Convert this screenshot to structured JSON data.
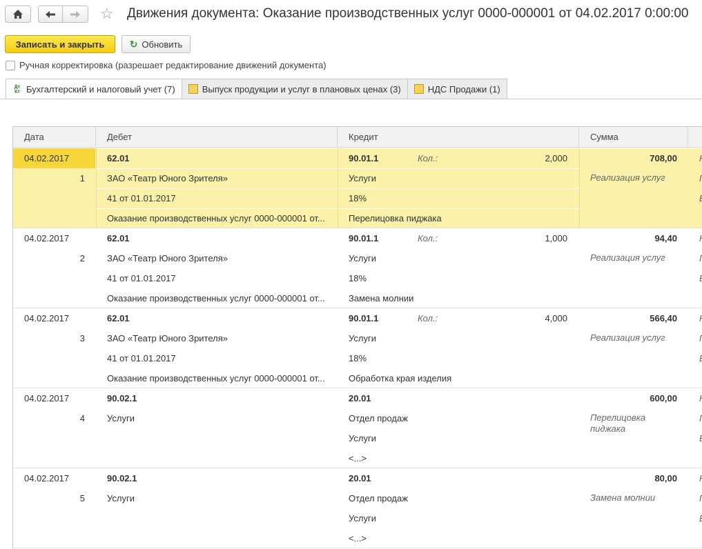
{
  "title": "Движения документа: Оказание производственных услуг 0000-000001 от 04.02.2017 0:00:00",
  "toolbar": {
    "save_close": "Записать и закрыть",
    "refresh": "Обновить"
  },
  "manual_edit": {
    "label": "Ручная корректировка (разрешает редактирование движений документа)",
    "checked": false
  },
  "tabs": [
    {
      "label": "Бухгалтерский и налоговый учет (7)",
      "active": true
    },
    {
      "label": "Выпуск продукции и услуг в плановых ценах (3)",
      "active": false
    },
    {
      "label": "НДС Продажи (1)",
      "active": false
    }
  ],
  "columns": {
    "date": "Дата",
    "debit": "Дебет",
    "credit": "Кредит",
    "sum": "Сумма"
  },
  "rows": [
    {
      "date": "04.02.2017",
      "num": "1",
      "debit": [
        "62.01",
        "ЗАО «Театр Юного Зрителя»",
        "41 от 01.01.2017",
        "Оказание производственных услуг 0000-000001 от..."
      ],
      "credit": [
        "90.01.1",
        "Услуги",
        "18%",
        "Перелицовка пиджака"
      ],
      "qty_label": "Кол.:",
      "qty": "2,000",
      "sum": "708,00",
      "content": "Реализация услуг",
      "extra": [
        "Н",
        "П",
        "Е"
      ]
    },
    {
      "date": "04.02.2017",
      "num": "2",
      "debit": [
        "62.01",
        "ЗАО «Театр Юного Зрителя»",
        "41 от 01.01.2017",
        "Оказание производственных услуг 0000-000001 от..."
      ],
      "credit": [
        "90.01.1",
        "Услуги",
        "18%",
        "Замена молнии"
      ],
      "qty_label": "Кол.:",
      "qty": "1,000",
      "sum": "94,40",
      "content": "Реализация услуг",
      "extra": [
        "Н",
        "П",
        "Е"
      ]
    },
    {
      "date": "04.02.2017",
      "num": "3",
      "debit": [
        "62.01",
        "ЗАО «Театр Юного Зрителя»",
        "41 от 01.01.2017",
        "Оказание производственных услуг 0000-000001 от..."
      ],
      "credit": [
        "90.01.1",
        "Услуги",
        "18%",
        "Обработка края изделия"
      ],
      "qty_label": "Кол.:",
      "qty": "4,000",
      "sum": "566,40",
      "content": "Реализация услуг",
      "extra": [
        "Н",
        "П",
        "Е"
      ]
    },
    {
      "date": "04.02.2017",
      "num": "4",
      "debit": [
        "90.02.1",
        "Услуги",
        "",
        ""
      ],
      "credit": [
        "20.01",
        "Отдел продаж",
        "Услуги",
        "<...>"
      ],
      "qty_label": "",
      "qty": "",
      "sum": "600,00",
      "content": "Перелицовка\nпиджака",
      "extra": [
        "Н",
        "П",
        "Е"
      ]
    },
    {
      "date": "04.02.2017",
      "num": "5",
      "debit": [
        "90.02.1",
        "Услуги",
        "",
        ""
      ],
      "credit": [
        "20.01",
        "Отдел продаж",
        "Услуги",
        "<...>"
      ],
      "qty_label": "",
      "qty": "",
      "sum": "80,00",
      "content": "Замена молнии",
      "extra": [
        "Н",
        "П",
        "Е"
      ]
    }
  ]
}
